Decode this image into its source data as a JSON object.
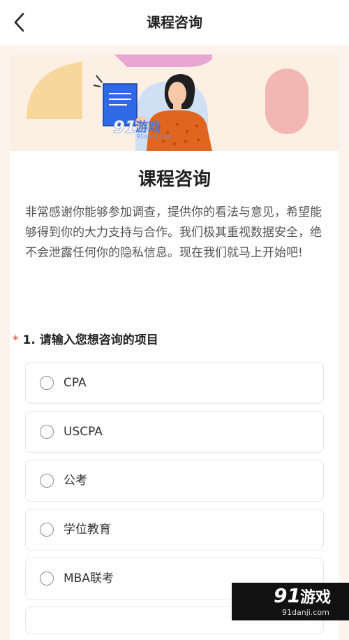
{
  "nav": {
    "title": "课程咨询",
    "back_icon": "chevron-left-icon"
  },
  "banner": {
    "illustration": "woman-holding-document-illustration",
    "watermark_text": "游戏",
    "watermark_url": "91danji.com"
  },
  "form": {
    "title": "课程咨询",
    "intro": "非常感谢你能够参加调查，提供你的看法与意见，希望能够得到你的大力支持与合作。我们极其重视数据安全，绝不会泄露任何你的隐私信息。现在我们就马上开始吧!",
    "question": {
      "required_mark": "*",
      "text": "1. 请输入您想咨询的项目",
      "options": [
        {
          "label": "CPA"
        },
        {
          "label": "USCPA"
        },
        {
          "label": "公考"
        },
        {
          "label": "学位教育"
        },
        {
          "label": "MBA联考"
        }
      ]
    }
  },
  "watermark": {
    "brand": "游戏",
    "url": "91danji.com"
  },
  "colors": {
    "required": "#e5452d",
    "banner_bg": "#fcefe3",
    "page_bg": "#fbf3ec"
  }
}
